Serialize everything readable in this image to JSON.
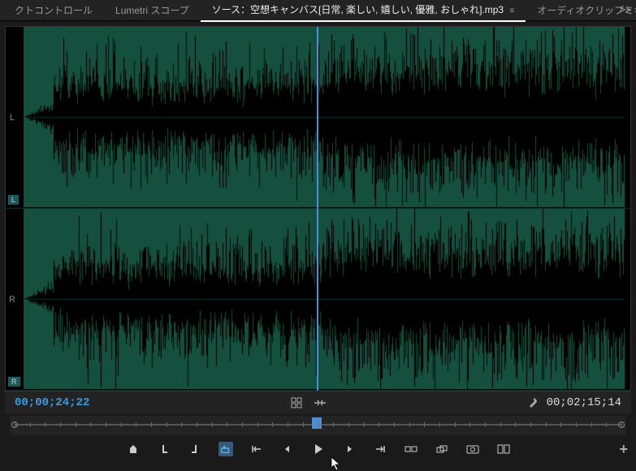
{
  "tabs": {
    "control": "クトコントロール",
    "lumetri": "Lumetri スコープ",
    "source": "ソース：空想キャンバス[日常, 楽しい, 嬉しい, 優雅, おしゃれ].mp3",
    "source_menu": "≡",
    "audio_mixer": "オーディオクリップミキサー",
    "overflow": ">>"
  },
  "channels": {
    "left": {
      "label": "L",
      "sub": "L"
    },
    "right": {
      "label": "R",
      "sub": "R"
    }
  },
  "timecode": {
    "current": "00;00;24;22",
    "duration": "00;02;15;14"
  },
  "icons": {
    "grid": "grid",
    "snap": "snap",
    "wrench": "wrench",
    "plus": "+"
  },
  "colors": {
    "waveform": "#2a9d7a",
    "playhead": "#4a90d9",
    "timecode_active": "#3a9bdc",
    "background": "#1a1a1a"
  }
}
